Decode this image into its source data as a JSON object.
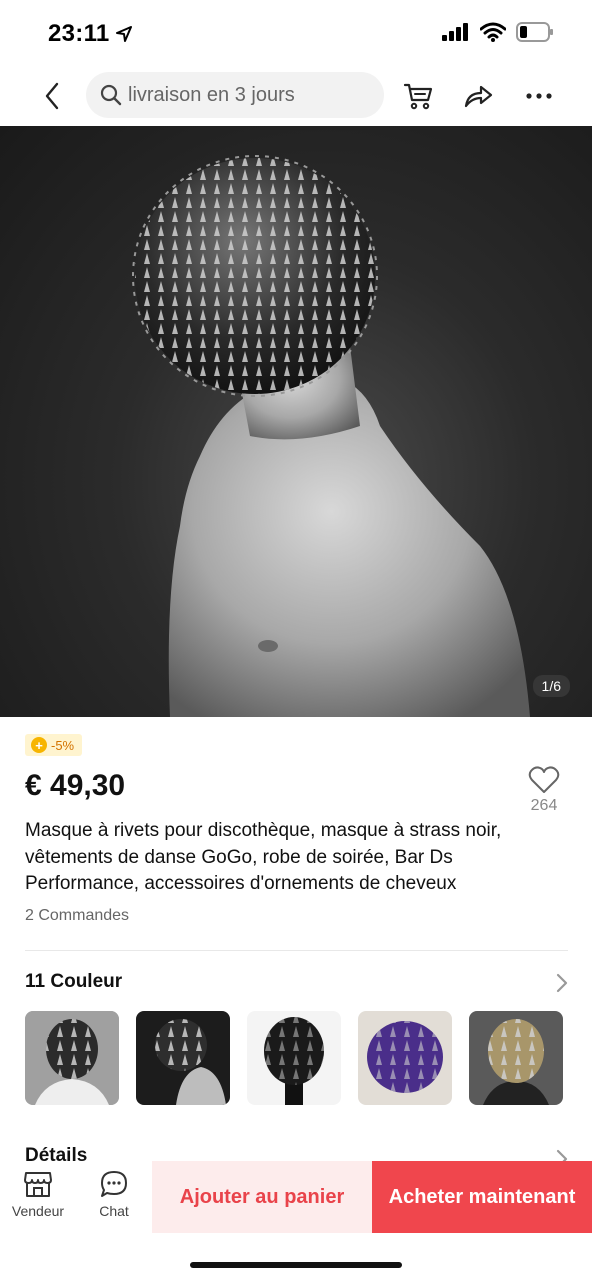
{
  "status_bar": {
    "time": "23:11"
  },
  "search": {
    "placeholder": "livraison en 3 jours"
  },
  "hero": {
    "counter": "1/6"
  },
  "product": {
    "discount": "-5%",
    "price": "€ 49,30",
    "wishlist_count": "264",
    "title": "Masque à rivets pour discothèque, masque à strass noir, vêtements de danse GoGo, robe de soirée, Bar Ds Performance, accessoires d'ornements de cheveux",
    "orders": "2 Commandes"
  },
  "colors": {
    "title": "11 Couleur"
  },
  "details": {
    "title": "Détails"
  },
  "bottom_bar": {
    "seller_label": "Vendeur",
    "chat_label": "Chat",
    "add_to_cart": "Ajouter au panier",
    "buy_now": "Acheter maintenant"
  },
  "theme": {
    "accent": "#f0464d",
    "accent_light": "#fdecec",
    "badge_bg": "#fff4cf",
    "coin": "#f7b500"
  },
  "icons": [
    "location-arrow-icon",
    "signal-icon",
    "wifi-icon",
    "battery-icon",
    "back-chevron-icon",
    "search-icon",
    "cart-icon",
    "share-icon",
    "more-icon",
    "heart-icon",
    "chevron-right-icon",
    "store-icon",
    "chat-icon"
  ]
}
